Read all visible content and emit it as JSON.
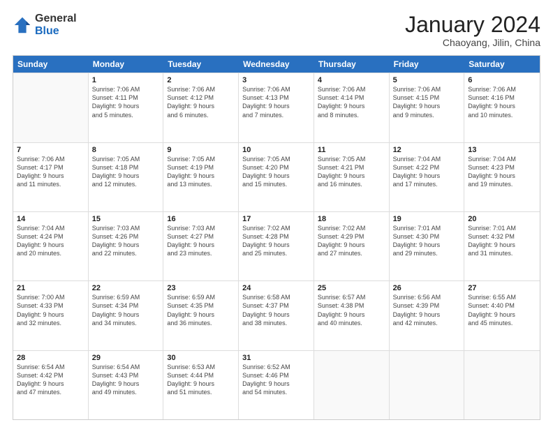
{
  "header": {
    "logo_general": "General",
    "logo_blue": "Blue",
    "month_title": "January 2024",
    "location": "Chaoyang, Jilin, China"
  },
  "weekdays": [
    "Sunday",
    "Monday",
    "Tuesday",
    "Wednesday",
    "Thursday",
    "Friday",
    "Saturday"
  ],
  "rows": [
    [
      {
        "day": "",
        "info": ""
      },
      {
        "day": "1",
        "info": "Sunrise: 7:06 AM\nSunset: 4:11 PM\nDaylight: 9 hours\nand 5 minutes."
      },
      {
        "day": "2",
        "info": "Sunrise: 7:06 AM\nSunset: 4:12 PM\nDaylight: 9 hours\nand 6 minutes."
      },
      {
        "day": "3",
        "info": "Sunrise: 7:06 AM\nSunset: 4:13 PM\nDaylight: 9 hours\nand 7 minutes."
      },
      {
        "day": "4",
        "info": "Sunrise: 7:06 AM\nSunset: 4:14 PM\nDaylight: 9 hours\nand 8 minutes."
      },
      {
        "day": "5",
        "info": "Sunrise: 7:06 AM\nSunset: 4:15 PM\nDaylight: 9 hours\nand 9 minutes."
      },
      {
        "day": "6",
        "info": "Sunrise: 7:06 AM\nSunset: 4:16 PM\nDaylight: 9 hours\nand 10 minutes."
      }
    ],
    [
      {
        "day": "7",
        "info": "Sunrise: 7:06 AM\nSunset: 4:17 PM\nDaylight: 9 hours\nand 11 minutes."
      },
      {
        "day": "8",
        "info": "Sunrise: 7:05 AM\nSunset: 4:18 PM\nDaylight: 9 hours\nand 12 minutes."
      },
      {
        "day": "9",
        "info": "Sunrise: 7:05 AM\nSunset: 4:19 PM\nDaylight: 9 hours\nand 13 minutes."
      },
      {
        "day": "10",
        "info": "Sunrise: 7:05 AM\nSunset: 4:20 PM\nDaylight: 9 hours\nand 15 minutes."
      },
      {
        "day": "11",
        "info": "Sunrise: 7:05 AM\nSunset: 4:21 PM\nDaylight: 9 hours\nand 16 minutes."
      },
      {
        "day": "12",
        "info": "Sunrise: 7:04 AM\nSunset: 4:22 PM\nDaylight: 9 hours\nand 17 minutes."
      },
      {
        "day": "13",
        "info": "Sunrise: 7:04 AM\nSunset: 4:23 PM\nDaylight: 9 hours\nand 19 minutes."
      }
    ],
    [
      {
        "day": "14",
        "info": "Sunrise: 7:04 AM\nSunset: 4:24 PM\nDaylight: 9 hours\nand 20 minutes."
      },
      {
        "day": "15",
        "info": "Sunrise: 7:03 AM\nSunset: 4:26 PM\nDaylight: 9 hours\nand 22 minutes."
      },
      {
        "day": "16",
        "info": "Sunrise: 7:03 AM\nSunset: 4:27 PM\nDaylight: 9 hours\nand 23 minutes."
      },
      {
        "day": "17",
        "info": "Sunrise: 7:02 AM\nSunset: 4:28 PM\nDaylight: 9 hours\nand 25 minutes."
      },
      {
        "day": "18",
        "info": "Sunrise: 7:02 AM\nSunset: 4:29 PM\nDaylight: 9 hours\nand 27 minutes."
      },
      {
        "day": "19",
        "info": "Sunrise: 7:01 AM\nSunset: 4:30 PM\nDaylight: 9 hours\nand 29 minutes."
      },
      {
        "day": "20",
        "info": "Sunrise: 7:01 AM\nSunset: 4:32 PM\nDaylight: 9 hours\nand 31 minutes."
      }
    ],
    [
      {
        "day": "21",
        "info": "Sunrise: 7:00 AM\nSunset: 4:33 PM\nDaylight: 9 hours\nand 32 minutes."
      },
      {
        "day": "22",
        "info": "Sunrise: 6:59 AM\nSunset: 4:34 PM\nDaylight: 9 hours\nand 34 minutes."
      },
      {
        "day": "23",
        "info": "Sunrise: 6:59 AM\nSunset: 4:35 PM\nDaylight: 9 hours\nand 36 minutes."
      },
      {
        "day": "24",
        "info": "Sunrise: 6:58 AM\nSunset: 4:37 PM\nDaylight: 9 hours\nand 38 minutes."
      },
      {
        "day": "25",
        "info": "Sunrise: 6:57 AM\nSunset: 4:38 PM\nDaylight: 9 hours\nand 40 minutes."
      },
      {
        "day": "26",
        "info": "Sunrise: 6:56 AM\nSunset: 4:39 PM\nDaylight: 9 hours\nand 42 minutes."
      },
      {
        "day": "27",
        "info": "Sunrise: 6:55 AM\nSunset: 4:40 PM\nDaylight: 9 hours\nand 45 minutes."
      }
    ],
    [
      {
        "day": "28",
        "info": "Sunrise: 6:54 AM\nSunset: 4:42 PM\nDaylight: 9 hours\nand 47 minutes."
      },
      {
        "day": "29",
        "info": "Sunrise: 6:54 AM\nSunset: 4:43 PM\nDaylight: 9 hours\nand 49 minutes."
      },
      {
        "day": "30",
        "info": "Sunrise: 6:53 AM\nSunset: 4:44 PM\nDaylight: 9 hours\nand 51 minutes."
      },
      {
        "day": "31",
        "info": "Sunrise: 6:52 AM\nSunset: 4:46 PM\nDaylight: 9 hours\nand 54 minutes."
      },
      {
        "day": "",
        "info": ""
      },
      {
        "day": "",
        "info": ""
      },
      {
        "day": "",
        "info": ""
      }
    ]
  ]
}
